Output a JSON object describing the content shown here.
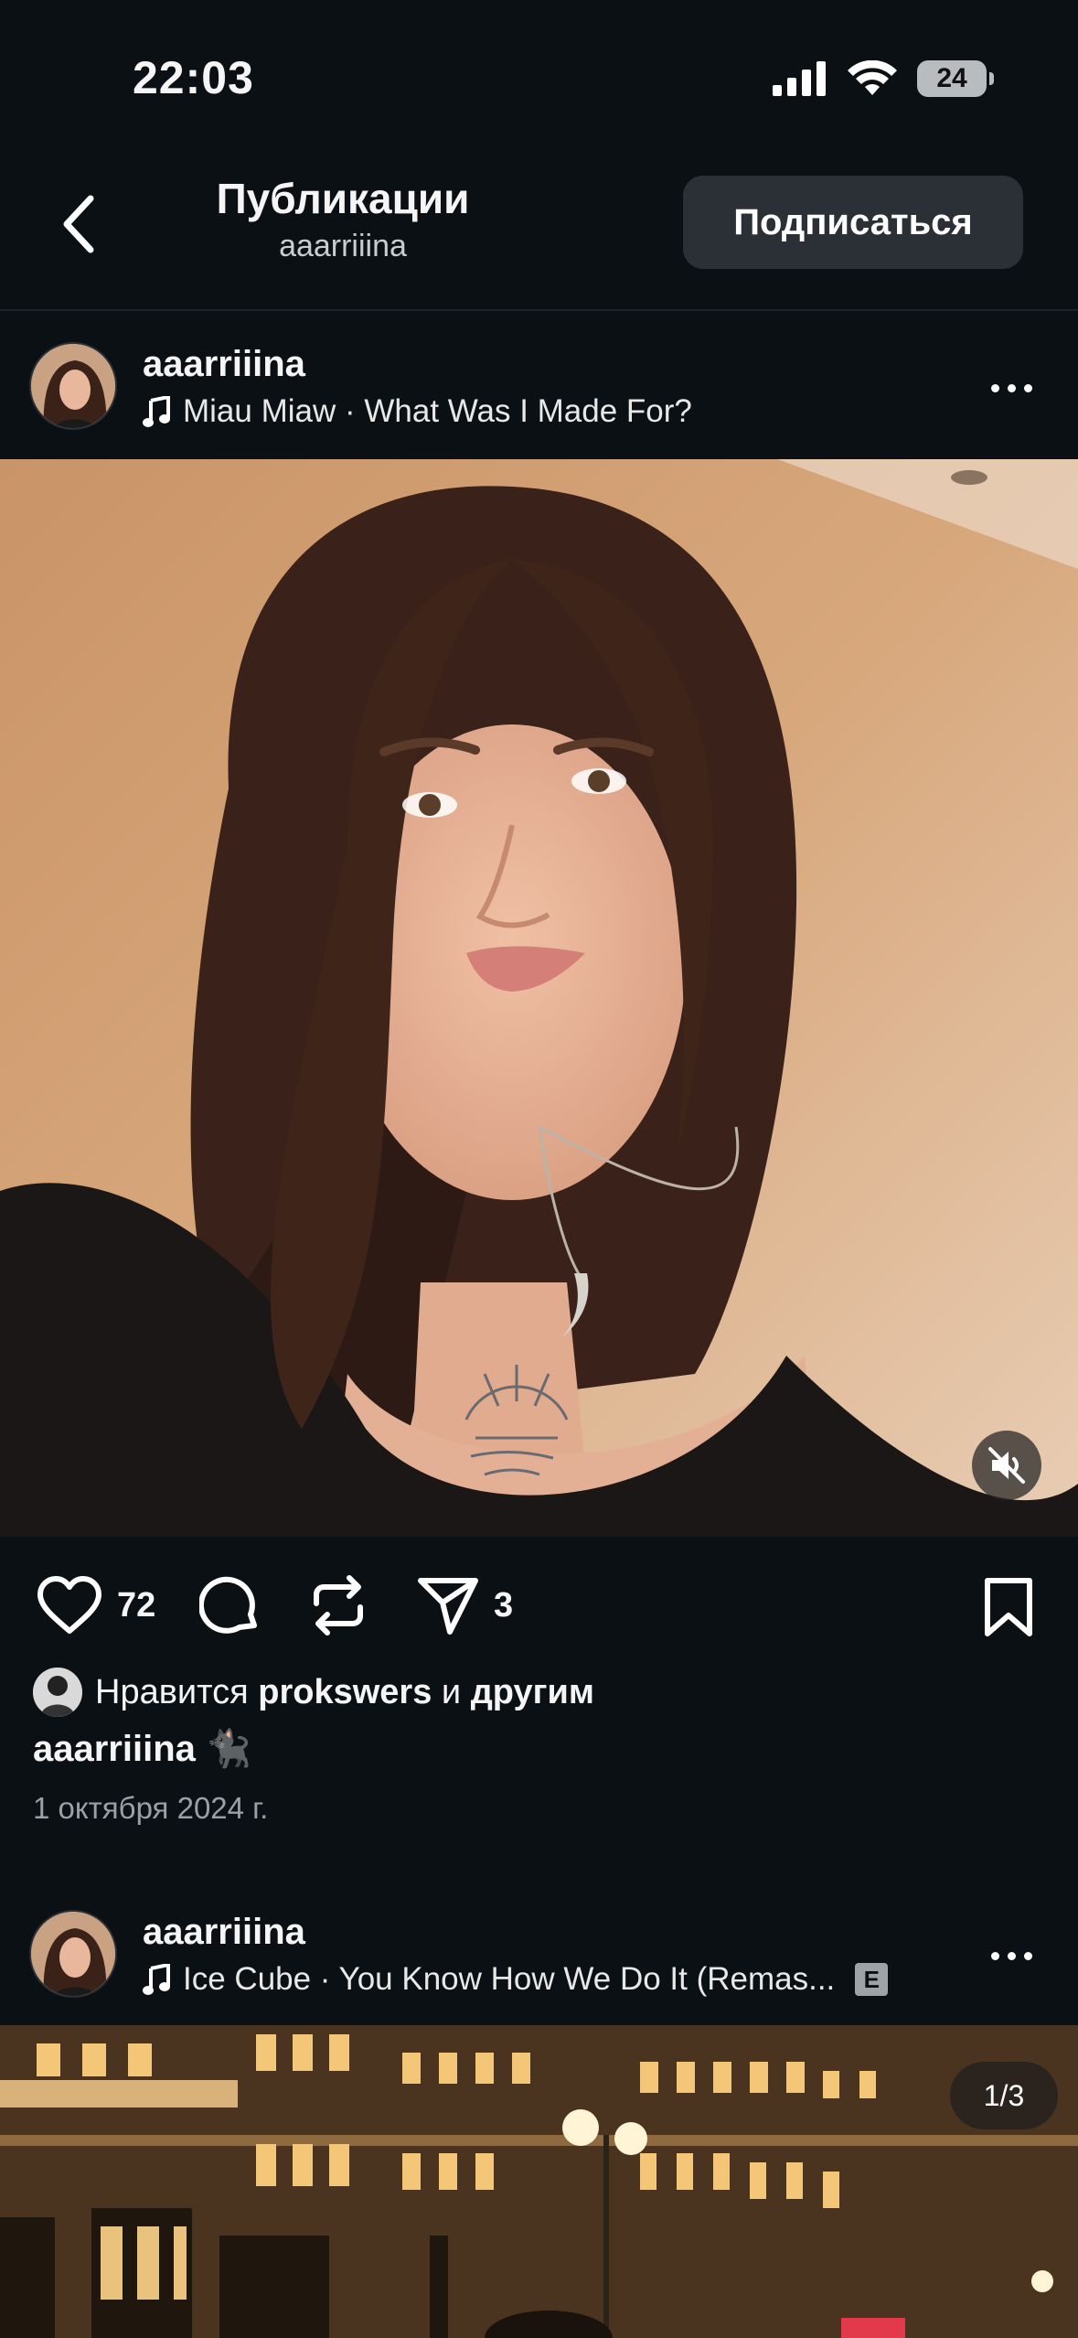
{
  "status_bar": {
    "time": "22:03",
    "battery": "24",
    "icons": [
      "signal-icon",
      "wifi-icon",
      "battery-icon"
    ]
  },
  "header": {
    "title": "Публикации",
    "subtitle": "aaarriiina",
    "subscribe_label": "Подписаться"
  },
  "posts": [
    {
      "username": "aaarriiina",
      "music": "Miau Miaw · What Was I Made For?",
      "actions": {
        "likes_count": "72",
        "shares_count": "3"
      },
      "liked_by": {
        "prefix": "Нравится ",
        "user": "prokswers",
        "middle": " и ",
        "others": "другим"
      },
      "caption": "aaarriiina 🐈‍⬛",
      "date": "1 октября 2024 г."
    },
    {
      "username": "aaarriiina",
      "music": "Ice Cube · You Know How We Do It (Remas...",
      "explicit": "E",
      "page_indicator": "1/3"
    }
  ],
  "colors": {
    "background": "#0b1014",
    "button_bg": "#2a3035",
    "muted_text": "#9aa0a6"
  }
}
